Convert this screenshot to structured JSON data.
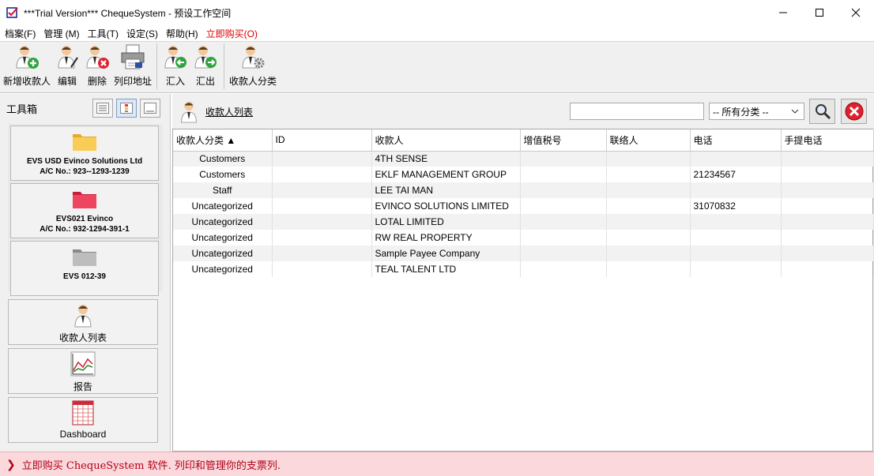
{
  "window": {
    "title": "***Trial Version*** ChequeSystem - 预设工作空间"
  },
  "menu": [
    "档案(F)",
    "管理 (M)",
    "工具(T)",
    "设定(S)",
    "帮助(H)",
    "立即购买(O)"
  ],
  "toolbar": {
    "add_payee": "新增收款人",
    "edit": "编辑",
    "delete": "删除",
    "print_address": "列印地址",
    "import": "汇入",
    "export": "汇出",
    "payee_category": "收款人分类"
  },
  "toolbox": {
    "title": "工具箱"
  },
  "accounts": [
    {
      "name": "EVS USD Evinco Solutions Ltd",
      "account": "A/C No.: 923--1293-1239",
      "color": "#f5c23a"
    },
    {
      "name": "EVS021 Evinco",
      "account": "A/C No.: 932-1294-391-1",
      "color": "#e8304a"
    },
    {
      "name": "EVS 012-39",
      "account": "",
      "color": "#a8a8a8"
    }
  ],
  "nav": {
    "payee_list": "收款人列表",
    "report": "报告",
    "dashboard": "Dashboard"
  },
  "main": {
    "title": "收款人列表",
    "search_value": "",
    "category_selected": "-- 所有分类 --"
  },
  "table": {
    "columns": [
      "收款人分类 ▲",
      "ID",
      "收款人",
      "增值税号",
      "联络人",
      "电话",
      "手提电话"
    ],
    "rows": [
      [
        "Customers",
        "",
        "4TH SENSE",
        "",
        "",
        "",
        ""
      ],
      [
        "Customers",
        "",
        "EKLF MANAGEMENT GROUP",
        "",
        "",
        "21234567",
        ""
      ],
      [
        "Staff",
        "",
        "LEE TAI MAN",
        "",
        "",
        "",
        ""
      ],
      [
        "Uncategorized",
        "",
        "EVINCO SOLUTIONS LIMITED",
        "",
        "",
        "31070832",
        ""
      ],
      [
        "Uncategorized",
        "",
        "LOTAL  LIMITED",
        "",
        "",
        "",
        ""
      ],
      [
        "Uncategorized",
        "",
        "RW REAL PROPERTY",
        "",
        "",
        "",
        ""
      ],
      [
        "Uncategorized",
        "",
        "Sample Payee Company",
        "",
        "",
        "",
        ""
      ],
      [
        "Uncategorized",
        "",
        "TEAL TALENT LTD",
        "",
        "",
        "",
        ""
      ]
    ]
  },
  "status": {
    "message": "立即购买 ChequeSystem 软件. 列印和管理你的支票列."
  },
  "colors": {
    "buy_red": "#e00000",
    "status_bg": "#fbd8dc",
    "status_text": "#b00018"
  }
}
